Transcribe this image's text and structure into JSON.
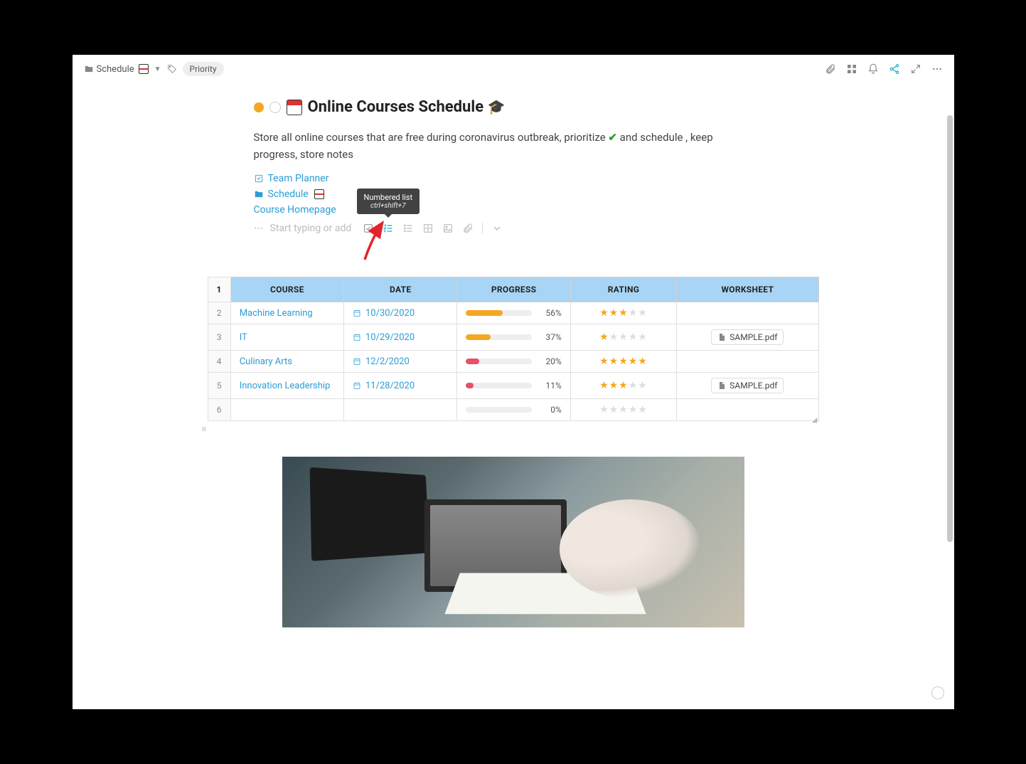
{
  "breadcrumb": {
    "label": "Schedule",
    "tag": "Priority"
  },
  "title": "Online Courses Schedule",
  "description_pre": "Store all online courses that are free during coronavirus outbreak, prioritize ",
  "description_post": " and schedule , keep progress, store notes",
  "links": {
    "planner": "Team Planner",
    "schedule": "Schedule",
    "homepage": "Course Homepage"
  },
  "placeholder": "Start typing or add",
  "tooltip": {
    "title": "Numbered list",
    "shortcut": "ctrl+shift+7"
  },
  "table": {
    "headers": {
      "course": "COURSE",
      "date": "DATE",
      "progress": "PROGRESS",
      "rating": "RATING",
      "worksheet": "WORKSHEET"
    },
    "rows": [
      {
        "n": "1"
      },
      {
        "n": "2",
        "course": "Machine Learning",
        "date": "10/30/2020",
        "progress": 56,
        "color": "#f5a623",
        "rating": 3,
        "worksheet": ""
      },
      {
        "n": "3",
        "course": "IT",
        "date": "10/29/2020",
        "progress": 37,
        "color": "#f5a623",
        "rating": 1,
        "worksheet": "SAMPLE.pdf"
      },
      {
        "n": "4",
        "course": "Culinary Arts",
        "date": "12/2/2020",
        "progress": 20,
        "color": "#e8506a",
        "rating": 5,
        "worksheet": ""
      },
      {
        "n": "5",
        "course": "Innovation Leadership",
        "date": "11/28/2020",
        "progress": 11,
        "color": "#e8506a",
        "rating": 3,
        "worksheet": "SAMPLE.pdf"
      },
      {
        "n": "6",
        "course": "",
        "date": "",
        "progress": 0,
        "color": "#eee",
        "rating": 0,
        "worksheet": ""
      }
    ]
  }
}
